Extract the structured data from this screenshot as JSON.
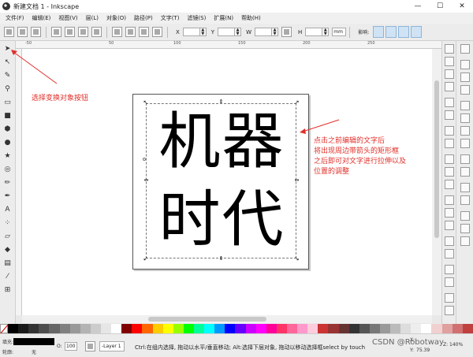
{
  "window": {
    "title": "新建文档 1 - Inkscape",
    "controls": {
      "minimize": "—",
      "maximize": "☐",
      "close": "✕"
    }
  },
  "menubar": {
    "items": [
      {
        "label": "文件(F)"
      },
      {
        "label": "编辑(E)"
      },
      {
        "label": "视图(V)"
      },
      {
        "label": "层(L)"
      },
      {
        "label": "对象(O)"
      },
      {
        "label": "路径(P)"
      },
      {
        "label": "文字(T)"
      },
      {
        "label": "滤镜(S)"
      },
      {
        "label": "扩展(N)"
      },
      {
        "label": "帮助(H)"
      }
    ]
  },
  "toolbar": {
    "x_label": "X",
    "y_label": "Y",
    "w_label": "W",
    "h_label": "H",
    "unit": "mm",
    "affect_label": "影响:"
  },
  "ruler": {
    "ticks": [
      "-50",
      "50",
      "100",
      "150",
      "200",
      "250"
    ]
  },
  "canvas": {
    "text_line1": "机器",
    "text_line2": "时代",
    "handle_corner": "↖",
    "handle_side": "⇕"
  },
  "annotations": {
    "left_note": "选择变换对象按钮",
    "right_note": [
      "点击之前编辑的文字后",
      "将出现周边带箭头的矩形框",
      "之后即可对文字进行拉伸以及",
      "位置的调整"
    ]
  },
  "palette": {
    "colors": [
      "#000000",
      "#1a1a1a",
      "#333333",
      "#4d4d4d",
      "#666666",
      "#808080",
      "#999999",
      "#b3b3b3",
      "#cccccc",
      "#e6e6e6",
      "#ffffff",
      "#800000",
      "#ff0000",
      "#ff6600",
      "#ffcc00",
      "#ffff00",
      "#99ff00",
      "#00ff00",
      "#00ff99",
      "#00ffff",
      "#0099ff",
      "#0000ff",
      "#6600ff",
      "#cc00ff",
      "#ff00ff",
      "#ff0099",
      "#ff3366",
      "#ff6699",
      "#ff99cc",
      "#ffccdd",
      "#cc3333",
      "#993333",
      "#663333",
      "#333333",
      "#555555",
      "#777777",
      "#999999",
      "#bbbbbb",
      "#dddddd",
      "#eeeeee",
      "#ffffff",
      "#f0d0d0",
      "#e0a0a0",
      "#d07070",
      "#c04040"
    ]
  },
  "statusbar": {
    "fill_label": "填充:",
    "stroke_label": "轮廓:",
    "stroke_value": "无",
    "opacity_label": "O:",
    "opacity_value": "100",
    "layer_name": "-Layer 1",
    "message": "Ctrl:在组内选择, 拖动以水平/垂直移动; Alt:选择下层对象, 拖动以移动选择框select by touch",
    "x_label": "X:",
    "x_value": "",
    "y_label": "Y:",
    "y_value": "75.39",
    "zoom_label": "Z:",
    "zoom_value": "140%"
  },
  "watermark": "CSDN @Robotway"
}
